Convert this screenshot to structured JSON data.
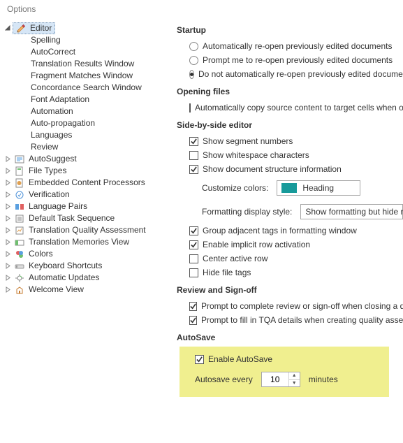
{
  "window": {
    "title": "Options"
  },
  "tree": {
    "editor": {
      "label": "Editor",
      "children": [
        "Spelling",
        "AutoCorrect",
        "Translation Results Window",
        "Fragment Matches Window",
        "Concordance Search Window",
        "Font Adaptation",
        "Automation",
        "Auto-propagation",
        "Languages",
        "Review"
      ]
    },
    "siblings": [
      "AutoSuggest",
      "File Types",
      "Embedded Content Processors",
      "Verification",
      "Language Pairs",
      "Default Task Sequence",
      "Translation Quality Assessment",
      "Translation Memories View",
      "Colors",
      "Keyboard Shortcuts",
      "Automatic Updates",
      "Welcome View"
    ]
  },
  "headings": {
    "startup": "Startup",
    "opening": "Opening files",
    "sbs": "Side-by-side editor",
    "review": "Review and Sign-off",
    "autosave": "AutoSave"
  },
  "startup": {
    "auto_reopen": "Automatically re-open previously edited documents",
    "prompt_reopen": "Prompt me to re-open previously edited documents",
    "no_reopen": "Do not automatically re-open previously edited documents",
    "selected": "no_reopen"
  },
  "opening": {
    "auto_copy": "Automatically copy source content to target cells when opening document"
  },
  "sbs": {
    "show_segment_numbers": "Show segment numbers",
    "show_whitespace": "Show whitespace characters",
    "show_doc_structure": "Show document structure information",
    "customize_colors_label": "Customize colors:",
    "color_name": "Heading",
    "formatting_label": "Formatting display style:",
    "formatting_value": "Show formatting but hide recognized tags",
    "group_tags": "Group adjacent tags in formatting window",
    "implicit_row": "Enable implicit row activation",
    "center_row": "Center active row",
    "hide_file_tags": "Hide file tags"
  },
  "review": {
    "prompt_complete": "Prompt to complete review or sign-off when closing a document",
    "prompt_tqa": "Prompt to fill in TQA details when creating quality assessment"
  },
  "autosave": {
    "enable": "Enable AutoSave",
    "every_label": "Autosave every",
    "value": "10",
    "unit": "minutes"
  }
}
